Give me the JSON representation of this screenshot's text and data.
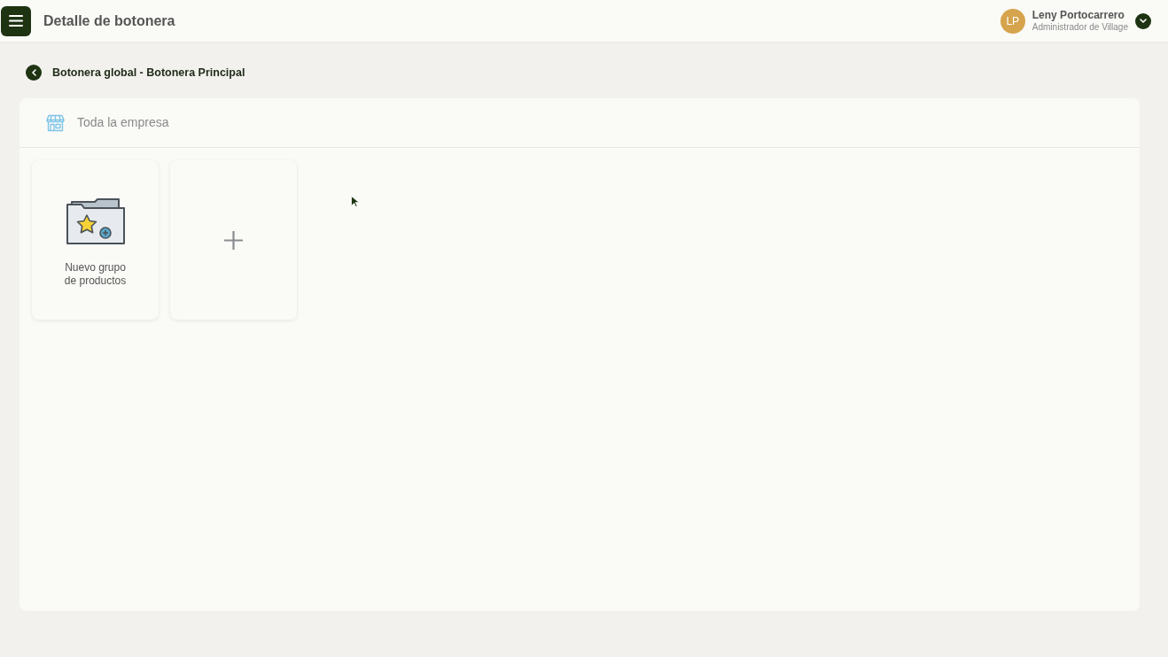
{
  "header": {
    "title": "Detalle de botonera",
    "user": {
      "initials": "LP",
      "name": "Leny Portocarrero",
      "role": "Administrador de Village"
    }
  },
  "breadcrumb": {
    "title": "Botonera global - Botonera Principal"
  },
  "panel": {
    "scope": "Toda la empresa",
    "tiles": [
      {
        "kind": "group",
        "label": "Nuevo grupo de productos"
      },
      {
        "kind": "add"
      }
    ]
  }
}
